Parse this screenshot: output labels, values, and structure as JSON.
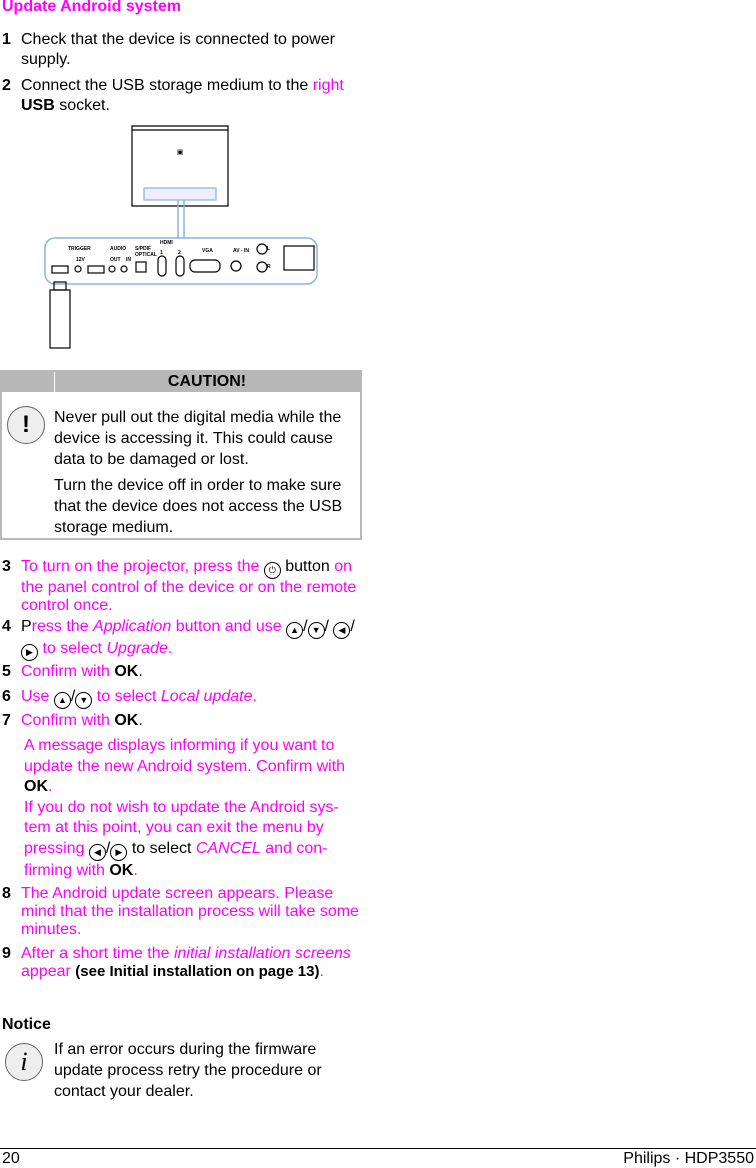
{
  "heading": "Update Android system",
  "steps": {
    "s1": {
      "n": "1",
      "text": "Check that the device is connected to power supply."
    },
    "s2": {
      "n": "2",
      "a": "Connect the USB storage medium to the ",
      "b": "right",
      "c": "USB",
      "d": " socket."
    },
    "s3": {
      "n": "3",
      "a": "To turn on the projector, press the ",
      "b": " button",
      "c": "on the panel control of the device or on the remote control once."
    },
    "s4": {
      "n": "4",
      "a": "P",
      "b": "ress the ",
      "c": "Application",
      "d": " button and use ",
      "e": " to select ",
      "f": "Upgrade",
      "g": "."
    },
    "s5": {
      "n": "5",
      "a": "Confirm with ",
      "b": "OK",
      "c": "."
    },
    "s6": {
      "n": "6",
      "a": "Use ",
      "b": " to select ",
      "c": "Local update",
      "d": "."
    },
    "s7": {
      "n": "7",
      "a": "Confirm with ",
      "b": "OK",
      "c": "."
    },
    "s8": {
      "n": "8",
      "text": "The Android update screen appears. Please mind that the installation process will take some minutes."
    },
    "s9": {
      "n": "9",
      "a": "After a short time the ",
      "b": "initial installation screens",
      "c": " appear ",
      "d": "(see Initial installation on page 13)",
      "e": "."
    }
  },
  "step7_note": {
    "a": "A message displays informing if you want to update the new Android system. Confirm with ",
    "b": "OK",
    "c": ".",
    "d": "If you do not wish to update the Android sys-tem at this point, you can exit the menu by pressing ",
    "e": " to select ",
    "f": "CANCEL",
    "g": " and con-firming with ",
    "h": "OK",
    "i": "."
  },
  "caution": {
    "title": "CAUTION!",
    "p1": "Never pull out the digital media while the device is accessing it. This could cause data to be damaged or lost.",
    "p2": "Turn the device off in order to make sure that the device does not access the USB storage medium."
  },
  "notice": {
    "title": "Notice",
    "text": "If an error occurs during the firmware update process retry the procedure or contact your dealer."
  },
  "illustration": {
    "labels": [
      "TRIGGER",
      "12V",
      "AUDIO",
      "OUT",
      "IN",
      "S/PDIF",
      "OPTICAL",
      "HDMI",
      "1",
      "2",
      "VGA",
      "AV - IN",
      "L",
      "R"
    ]
  },
  "footer": {
    "page": "20",
    "product": "Philips · HDP3550"
  },
  "colors": {
    "accent": "#ff00ff",
    "caution_header": "#b8b8b8",
    "diagram_line": "#8ab4e0"
  }
}
